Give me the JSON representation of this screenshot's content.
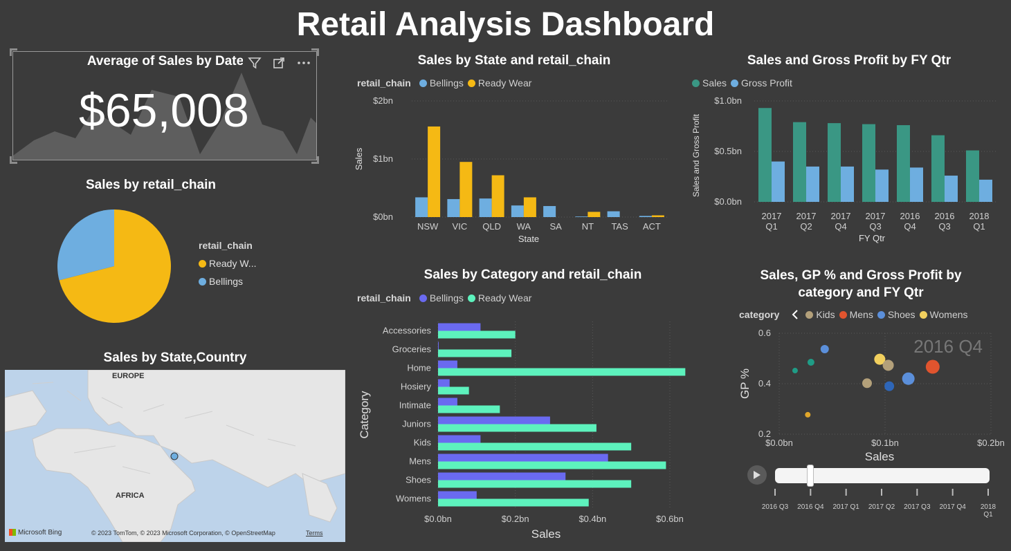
{
  "page": {
    "title": "Retail Analysis Dashboard"
  },
  "kpi": {
    "title": "Average of Sales by Date",
    "value": "$65,008",
    "icons": [
      "filter-icon",
      "focus-mode-icon",
      "more-options-icon"
    ]
  },
  "pie": {
    "title": "Sales by retail_chain",
    "legend_title": "retail_chain",
    "items": [
      {
        "label": "Ready W...",
        "color": "#F5B914",
        "share": 0.71
      },
      {
        "label": "Bellings",
        "color": "#6EAEE0",
        "share": 0.29
      }
    ]
  },
  "map": {
    "title": "Sales by State,Country",
    "labels": {
      "europe": "EUROPE",
      "africa": "AFRICA"
    },
    "brand": "Microsoft Bing",
    "copyright": "© 2023 TomTom, © 2023 Microsoft Corporation, © OpenStreetMap",
    "terms": "Terms"
  },
  "state_chart": {
    "title": "Sales by State and retail_chain",
    "legend_title": "retail_chain",
    "xlabel": "State",
    "ylabel": "Sales",
    "yticks": [
      "$0bn",
      "$1bn",
      "$2bn"
    ]
  },
  "fy_chart": {
    "title": "Sales and Gross Profit by FY Qtr",
    "xlabel": "FY Qtr",
    "ylabel": "Sales and Gross Profit",
    "yticks": [
      "$0.0bn",
      "$0.5bn",
      "$1.0bn"
    ]
  },
  "category_chart": {
    "title": "Sales by Category and retail_chain",
    "legend_title": "retail_chain",
    "xlabel": "Sales",
    "ylabel": "Category",
    "xticks": [
      "$0.0bn",
      "$0.2bn",
      "$0.4bn",
      "$0.6bn"
    ]
  },
  "scatter_chart": {
    "title_line1": "Sales, GP % and Gross Profit by",
    "title_line2": "category and FY Qtr",
    "legend_title": "category",
    "watermark": "2016 Q4",
    "xlabel": "Sales",
    "ylabel": "GP %",
    "xticks": [
      "$0.0bn",
      "$0.1bn",
      "$0.2bn"
    ],
    "yticks": [
      "0.6",
      "0.4",
      "0.2"
    ],
    "periods": [
      "2016 Q3",
      "2016 Q4",
      "2017 Q1",
      "2017 Q2",
      "2017 Q3",
      "2017 Q4",
      "2018 Q1"
    ],
    "play_icon": "play-icon"
  },
  "chart_data": [
    {
      "type": "bar",
      "title": "Sales by State and retail_chain",
      "xlabel": "State",
      "ylabel": "Sales",
      "ylim": [
        0,
        2
      ],
      "unit": "bn",
      "categories": [
        "NSW",
        "VIC",
        "QLD",
        "WA",
        "SA",
        "NT",
        "TAS",
        "ACT"
      ],
      "series": [
        {
          "name": "Bellings",
          "color": "#6EAEE0",
          "values": [
            0.34,
            0.31,
            0.32,
            0.2,
            0.19,
            0.01,
            0.1,
            0.02
          ]
        },
        {
          "name": "Ready Wear",
          "color": "#F5B914",
          "values": [
            1.56,
            0.95,
            0.72,
            0.34,
            0.0,
            0.09,
            0.0,
            0.03
          ]
        }
      ]
    },
    {
      "type": "bar",
      "title": "Sales and Gross Profit by FY Qtr",
      "xlabel": "FY Qtr",
      "ylabel": "Sales and Gross Profit",
      "ylim": [
        0,
        1.0
      ],
      "unit": "bn",
      "categories": [
        [
          "2017",
          "Q1"
        ],
        [
          "2017",
          "Q2"
        ],
        [
          "2017",
          "Q4"
        ],
        [
          "2017",
          "Q3"
        ],
        [
          "2016",
          "Q4"
        ],
        [
          "2016",
          "Q3"
        ],
        [
          "2018",
          "Q1"
        ]
      ],
      "series": [
        {
          "name": "Sales",
          "color": "#3A9784",
          "values": [
            0.93,
            0.79,
            0.78,
            0.77,
            0.76,
            0.66,
            0.51
          ]
        },
        {
          "name": "Gross Profit",
          "color": "#6EAEE0",
          "values": [
            0.4,
            0.35,
            0.35,
            0.32,
            0.34,
            0.26,
            0.22
          ]
        }
      ]
    },
    {
      "type": "bar",
      "orientation": "horizontal",
      "title": "Sales by Category and retail_chain",
      "xlabel": "Sales",
      "ylabel": "Category",
      "xlim": [
        0,
        0.6
      ],
      "unit": "bn",
      "categories": [
        "Accessories",
        "Groceries",
        "Home",
        "Hosiery",
        "Intimate",
        "Juniors",
        "Kids",
        "Mens",
        "Shoes",
        "Womens"
      ],
      "series": [
        {
          "name": "Bellings",
          "color": "#6A6AF0",
          "values": [
            0.11,
            0.0,
            0.05,
            0.03,
            0.05,
            0.29,
            0.11,
            0.44,
            0.33,
            0.1
          ]
        },
        {
          "name": "Ready Wear",
          "color": "#5DF2BD",
          "values": [
            0.2,
            0.19,
            0.64,
            0.08,
            0.16,
            0.41,
            0.5,
            0.59,
            0.5,
            0.39
          ]
        }
      ]
    },
    {
      "type": "scatter",
      "title": "Sales, GP % and Gross Profit by category and FY Qtr",
      "xlabel": "Sales",
      "ylabel": "GP %",
      "xlim": [
        0,
        0.2
      ],
      "ylim": [
        0.2,
        0.6
      ],
      "unit": "bn",
      "series": [
        {
          "name": "Kids",
          "color": "#B3A07A"
        },
        {
          "name": "Mens",
          "color": "#E0542E"
        },
        {
          "name": "Shoes",
          "color": "#5B8FDA"
        },
        {
          "name": "Womens",
          "color": "#F2D05E"
        }
      ],
      "points": [
        {
          "x": 0.015,
          "y": 0.452,
          "r": 4,
          "color": "#1F9C86"
        },
        {
          "x": 0.03,
          "y": 0.485,
          "r": 5,
          "color": "#1F9C86"
        },
        {
          "x": 0.027,
          "y": 0.277,
          "r": 4,
          "color": "#E0A62A"
        },
        {
          "x": 0.043,
          "y": 0.537,
          "r": 6,
          "color": "#5B8FDA"
        },
        {
          "x": 0.083,
          "y": 0.402,
          "r": 7,
          "color": "#B3A07A"
        },
        {
          "x": 0.095,
          "y": 0.497,
          "r": 8,
          "color": "#F2D05E"
        },
        {
          "x": 0.103,
          "y": 0.473,
          "r": 8,
          "color": "#B3A07A"
        },
        {
          "x": 0.104,
          "y": 0.39,
          "r": 7,
          "color": "#2E66B8"
        },
        {
          "x": 0.122,
          "y": 0.42,
          "r": 9,
          "color": "#5B8FDA"
        },
        {
          "x": 0.145,
          "y": 0.467,
          "r": 10,
          "color": "#E0542E"
        }
      ]
    }
  ]
}
